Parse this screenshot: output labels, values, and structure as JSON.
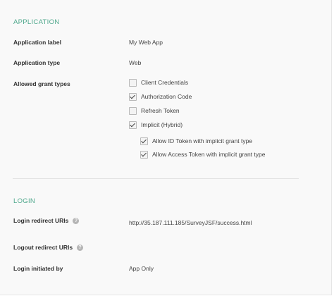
{
  "application": {
    "section_title": "APPLICATION",
    "label_label": "Application label",
    "label_value": "My Web App",
    "type_label": "Application type",
    "type_value": "Web",
    "grant_label": "Allowed grant types",
    "grants": [
      {
        "label": "Client Credentials",
        "checked": false
      },
      {
        "label": "Authorization Code",
        "checked": true
      },
      {
        "label": "Refresh Token",
        "checked": false
      },
      {
        "label": "Implicit (Hybrid)",
        "checked": true
      }
    ],
    "implicit_options": [
      {
        "label": "Allow ID Token with implicit grant type",
        "checked": true
      },
      {
        "label": "Allow Access Token with implicit grant type",
        "checked": true
      }
    ]
  },
  "login": {
    "section_title": "LOGIN",
    "redirect_label": "Login redirect URIs",
    "redirect_value": "http://35.187.111.185/SurveyJSF/success.html",
    "logout_label": "Logout redirect URIs",
    "initiated_label": "Login initiated by",
    "initiated_value": "App Only",
    "help_glyph": "?"
  }
}
